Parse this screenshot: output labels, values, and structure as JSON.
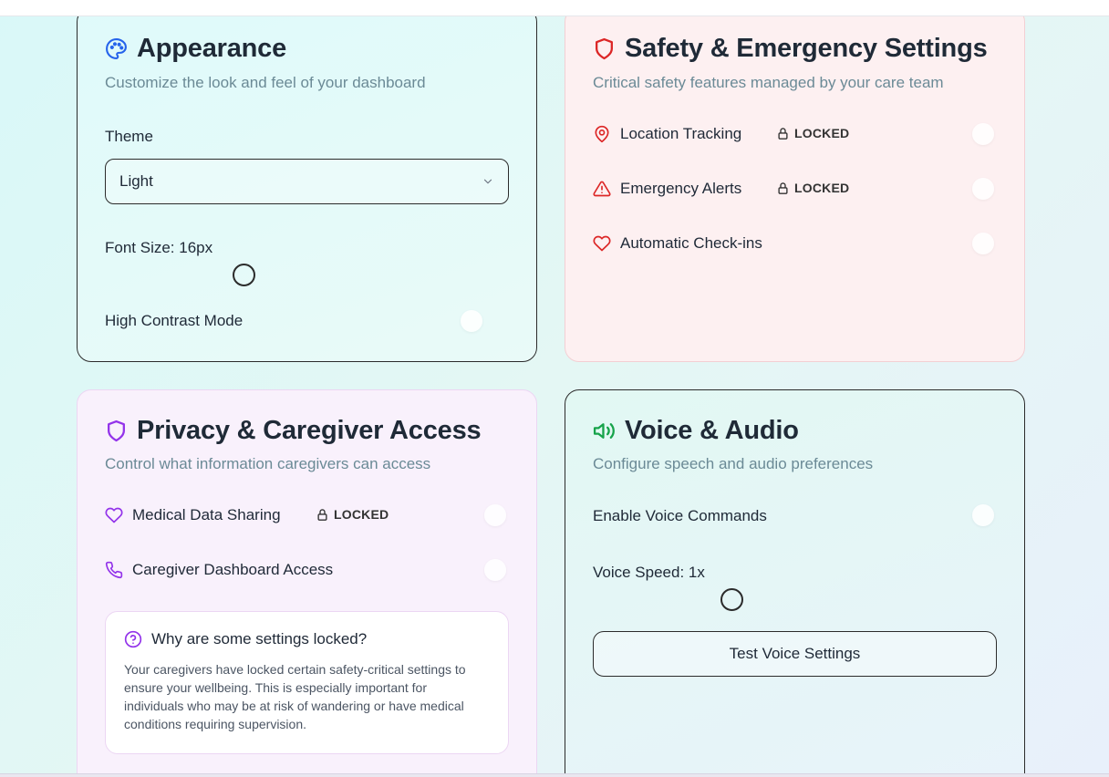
{
  "colors": {
    "appearance_accent": "#2563eb",
    "safety_accent": "#dc2626",
    "privacy_accent": "#9333ea",
    "voice_accent": "#16a34a"
  },
  "appearance": {
    "icon": "palette-icon",
    "title": "Appearance",
    "subtitle": "Customize the look and feel of your dashboard",
    "theme_label": "Theme",
    "theme_value": "Light",
    "font_size_label": "Font Size: 16px",
    "high_contrast_label": "High Contrast Mode"
  },
  "safety": {
    "icon": "shield-icon",
    "title": "Safety & Emergency Settings",
    "subtitle": "Critical safety features managed by your care team",
    "items": [
      {
        "icon": "map-pin-icon",
        "label": "Location Tracking",
        "locked": "LOCKED"
      },
      {
        "icon": "alert-triangle-icon",
        "label": "Emergency Alerts",
        "locked": "LOCKED"
      },
      {
        "icon": "heart-icon",
        "label": "Automatic Check-ins"
      }
    ]
  },
  "privacy": {
    "icon": "shield-icon",
    "title": "Privacy & Caregiver Access",
    "subtitle": "Control what information caregivers can access",
    "items": [
      {
        "icon": "heart-icon",
        "label": "Medical Data Sharing",
        "locked": "LOCKED"
      },
      {
        "icon": "phone-icon",
        "label": "Caregiver Dashboard Access"
      }
    ],
    "info_title": "Why are some settings locked?",
    "info_body": "Your caregivers have locked certain safety-critical settings to ensure your wellbeing. This is especially important for individuals who may be at risk of wandering or have medical conditions requiring supervision."
  },
  "voice": {
    "icon": "volume-icon",
    "title": "Voice & Audio",
    "subtitle": "Configure speech and audio preferences",
    "voice_commands_label": "Enable Voice Commands",
    "voice_speed_label": "Voice Speed: 1x",
    "test_button": "Test Voice Settings"
  }
}
